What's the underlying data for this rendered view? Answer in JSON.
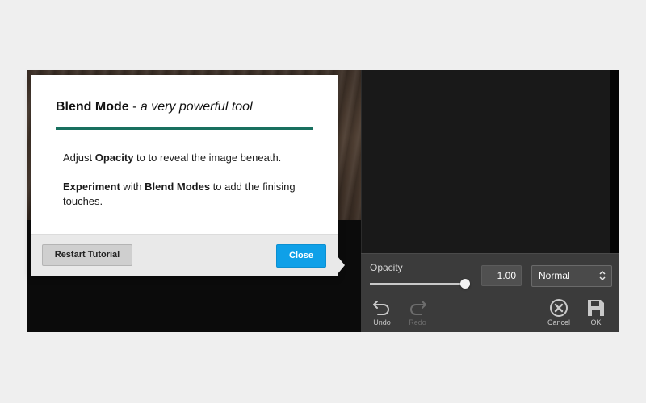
{
  "tutorial": {
    "title_strong": "Blend Mode",
    "title_sep": " - ",
    "title_sub": "a very powerful tool",
    "para1": {
      "t1": "Adjust ",
      "b1": "Opacity",
      "t2": " to to reveal the image beneath."
    },
    "para2": {
      "b1": "Experiment",
      "t1": " with ",
      "b2": "Blend Modes",
      "t2": " to add the finising touches."
    },
    "restart_label": "Restart Tutorial",
    "close_label": "Close"
  },
  "panel": {
    "opacity_label": "Opacity",
    "opacity_value": "1.00",
    "opacity_level": 1.0,
    "blend_mode": "Normal",
    "undo_label": "Undo",
    "redo_label": "Redo",
    "cancel_label": "Cancel",
    "ok_label": "OK"
  },
  "colors": {
    "accent_rule": "#18705f",
    "close_button": "#0fa0e8"
  },
  "icons": {
    "undo": "undo-arrow-icon",
    "redo": "redo-arrow-icon",
    "cancel": "close-circle-icon",
    "ok": "save-disk-icon",
    "select": "updown-chevron-icon"
  }
}
